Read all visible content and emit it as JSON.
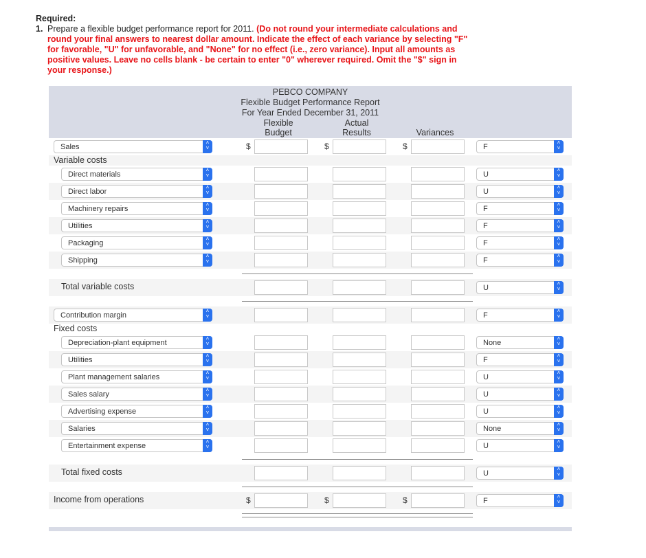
{
  "instructions": {
    "heading": "Required:",
    "item_number": "1.",
    "item_text": "Prepare a flexible budget performance report for 2011.",
    "item_note": "(Do not round your intermediate calculations and round your final answers to nearest dollar amount. Indicate the effect of each variance by selecting \"F\" for favorable, \"U\" for unfavorable, and \"None\" for no effect (i.e., zero variance). Input all amounts as positive values. Leave no cells blank - be certain to enter \"0\" wherever required. Omit the \"$\" sign in your response.)"
  },
  "report": {
    "company": "PEBCO COMPANY",
    "title": "Flexible Budget Performance Report",
    "period": "For Year Ended December 31, 2011",
    "columns": {
      "flexible_line1": "Flexible",
      "flexible_line2": "Budget",
      "actual_line1": "Actual",
      "actual_line2": "Results",
      "variances": "Variances"
    },
    "currency_symbol": "$"
  },
  "rows": {
    "sales": {
      "label": "Sales",
      "flexible": "",
      "actual": "",
      "variance": "",
      "effect": "F"
    },
    "variable_costs_heading": "Variable costs",
    "variable": [
      {
        "label": "Direct materials",
        "flexible": "",
        "actual": "",
        "variance": "",
        "effect": "U"
      },
      {
        "label": "Direct labor",
        "flexible": "",
        "actual": "",
        "variance": "",
        "effect": "U"
      },
      {
        "label": "Machinery repairs",
        "flexible": "",
        "actual": "",
        "variance": "",
        "effect": "F"
      },
      {
        "label": "Utilities",
        "flexible": "",
        "actual": "",
        "variance": "",
        "effect": "F"
      },
      {
        "label": "Packaging",
        "flexible": "",
        "actual": "",
        "variance": "",
        "effect": "F"
      },
      {
        "label": "Shipping",
        "flexible": "",
        "actual": "",
        "variance": "",
        "effect": "F"
      }
    ],
    "total_variable": {
      "label": "Total variable costs",
      "flexible": "",
      "actual": "",
      "variance": "",
      "effect": "U"
    },
    "contribution": {
      "label": "Contribution margin",
      "flexible": "",
      "actual": "",
      "variance": "",
      "effect": "F"
    },
    "fixed_costs_heading": "Fixed costs",
    "fixed": [
      {
        "label": "Depreciation-plant equipment",
        "flexible": "",
        "actual": "",
        "variance": "",
        "effect": "None"
      },
      {
        "label": "Utilities",
        "flexible": "",
        "actual": "",
        "variance": "",
        "effect": "F"
      },
      {
        "label": "Plant management salaries",
        "flexible": "",
        "actual": "",
        "variance": "",
        "effect": "U"
      },
      {
        "label": "Sales salary",
        "flexible": "",
        "actual": "",
        "variance": "",
        "effect": "U"
      },
      {
        "label": "Advertising expense",
        "flexible": "",
        "actual": "",
        "variance": "",
        "effect": "U"
      },
      {
        "label": "Salaries",
        "flexible": "",
        "actual": "",
        "variance": "",
        "effect": "None"
      },
      {
        "label": "Entertainment expense",
        "flexible": "",
        "actual": "",
        "variance": "",
        "effect": "U"
      }
    ],
    "total_fixed": {
      "label": "Total fixed costs",
      "flexible": "",
      "actual": "",
      "variance": "",
      "effect": "U"
    },
    "income": {
      "label": "Income from operations",
      "flexible": "",
      "actual": "",
      "variance": "",
      "effect": "F"
    }
  },
  "colors": {
    "header_bg": "#d8dbe6",
    "note_red": "#e8161a",
    "select_accent": "#2a72ee"
  }
}
